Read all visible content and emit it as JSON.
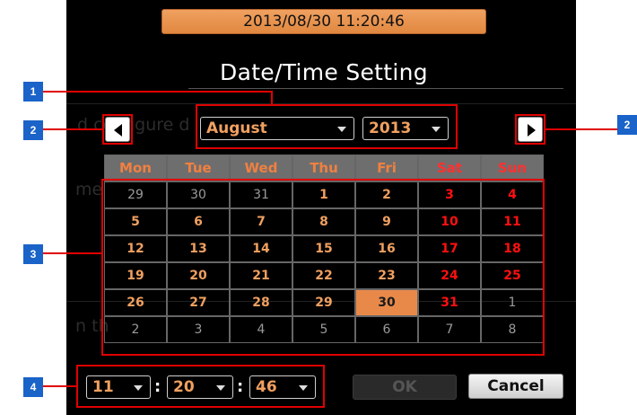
{
  "header": {
    "datetime": "2013/08/30 11:20:46",
    "title": "Date/Time Setting"
  },
  "background_text": {
    "line1": "d configure d",
    "line2": "me",
    "line3": "n th"
  },
  "month_select": {
    "value": "August"
  },
  "year_select": {
    "value": "2013"
  },
  "calendar": {
    "weekdays": [
      "Mon",
      "Tue",
      "Wed",
      "Thu",
      "Fri",
      "Sat",
      "Sun"
    ],
    "weeks": [
      [
        "29",
        "30",
        "31",
        "1",
        "2",
        "3",
        "4"
      ],
      [
        "5",
        "6",
        "7",
        "8",
        "9",
        "10",
        "11"
      ],
      [
        "12",
        "13",
        "14",
        "15",
        "16",
        "17",
        "18"
      ],
      [
        "19",
        "20",
        "21",
        "22",
        "23",
        "24",
        "25"
      ],
      [
        "26",
        "27",
        "28",
        "29",
        "30",
        "31",
        "1"
      ],
      [
        "2",
        "3",
        "4",
        "5",
        "6",
        "7",
        "8"
      ]
    ],
    "selected_day": "30"
  },
  "time": {
    "hour": "11",
    "minute": "20",
    "second": "46",
    "separator": ":"
  },
  "buttons": {
    "ok": "OK",
    "cancel": "Cancel"
  },
  "callouts": [
    "1",
    "2",
    "2",
    "3",
    "4"
  ],
  "colors": {
    "accent": "#f0a060",
    "weekend": "#ff1010",
    "selected": "#e8894a",
    "callout_line": "#e00000",
    "callout_badge": "#1a63c8"
  },
  "icons": {
    "prev": "triangle-left-icon",
    "next": "triangle-right-icon",
    "dropdown": "caret-down-icon"
  }
}
